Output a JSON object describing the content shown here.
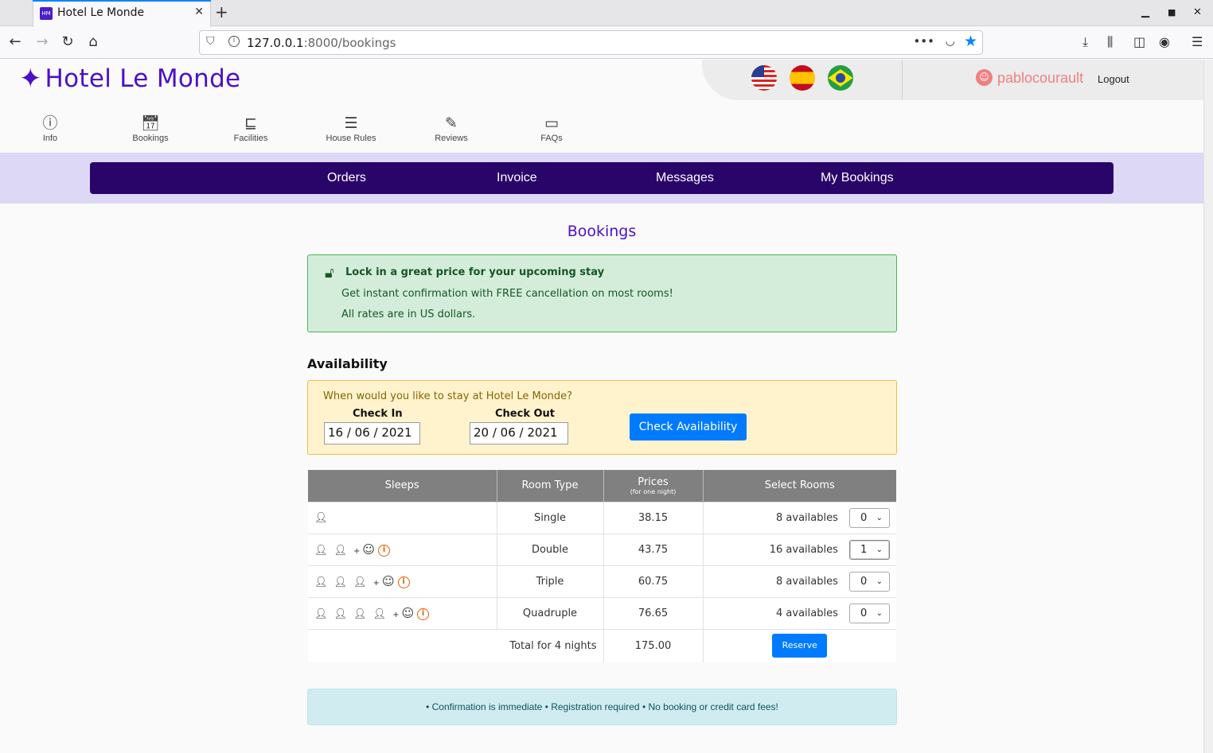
{
  "browser": {
    "tab_title": "Hotel Le Monde",
    "tab_favicon_text": "HM",
    "url_host": "127.0.0.1",
    "url_rest": ":8000/bookings"
  },
  "site": {
    "logo_text": "Hotel Le Monde",
    "username": "pablocourault",
    "logout": "Logout",
    "flags": [
      "us-flag",
      "es-flag",
      "br-flag"
    ]
  },
  "icon_nav": [
    {
      "label": "Info",
      "icon": "info-circle-icon"
    },
    {
      "label": "Bookings",
      "icon": "calendar-icon"
    },
    {
      "label": "Facilities",
      "icon": "bed-icon"
    },
    {
      "label": "House Rules",
      "icon": "rules-icon"
    },
    {
      "label": "Reviews",
      "icon": "reviews-icon"
    },
    {
      "label": "FAQs",
      "icon": "chat-icon"
    }
  ],
  "menu": [
    "Orders",
    "Invoice",
    "Messages",
    "My Bookings"
  ],
  "page_title": "Bookings",
  "promo": {
    "title": "Lock in a great price for your upcoming stay",
    "line1": "Get instant confirmation with FREE cancellation on most rooms!",
    "line2": "All rates are in US dollars."
  },
  "availability": {
    "heading": "Availability",
    "question": "When would you like to stay at Hotel Le Monde?",
    "checkin_label": "Check In",
    "checkin_value": "16 / 06 / 2021",
    "checkout_label": "Check Out",
    "checkout_value": "20 / 06 / 2021",
    "button": "Check Availability"
  },
  "table": {
    "headers": {
      "sleeps": "Sleeps",
      "room_type": "Room Type",
      "prices": "Prices",
      "prices_sub": "(for one night)",
      "select": "Select Rooms"
    },
    "rows": [
      {
        "adults": 1,
        "child": false,
        "type": "Single",
        "price": "38.15",
        "available": "8 availables",
        "selected": "0"
      },
      {
        "adults": 2,
        "child": true,
        "type": "Double",
        "price": "43.75",
        "available": "16 availables",
        "selected": "1"
      },
      {
        "adults": 3,
        "child": true,
        "type": "Triple",
        "price": "60.75",
        "available": "8 availables",
        "selected": "0"
      },
      {
        "adults": 4,
        "child": true,
        "type": "Quadruple",
        "price": "76.65",
        "available": "4 availables",
        "selected": "0"
      }
    ],
    "total_label": "Total for 4 nights",
    "total_value": "175.00",
    "reserve": "Reserve"
  },
  "footer_note": "• Confirmation is immediate  • Registration required  • No booking or credit card fees!",
  "colors": {
    "brand": "#4b10c8",
    "menu_bar": "#2a0569",
    "menu_band": "#ddd8f6",
    "primary_button": "#007bff"
  }
}
